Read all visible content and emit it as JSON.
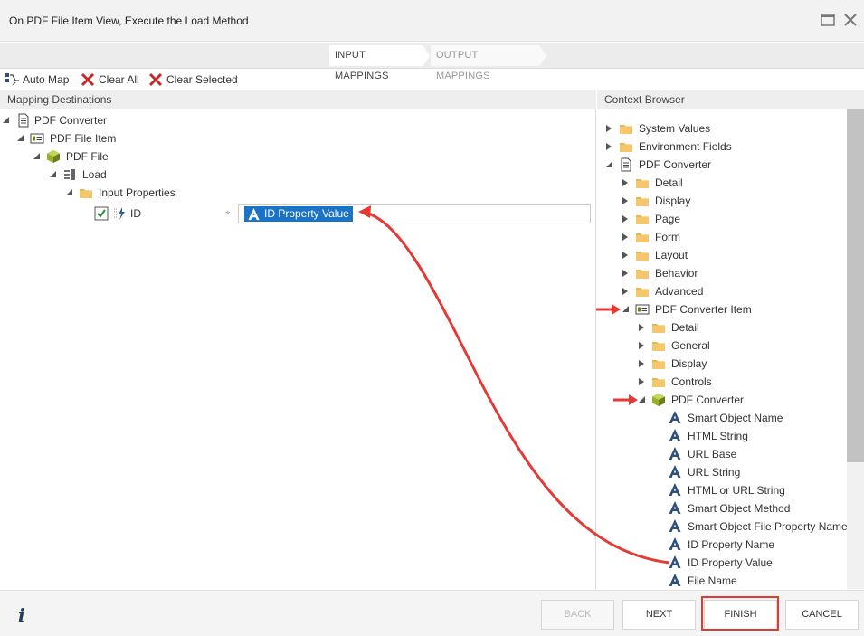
{
  "window": {
    "title": "On PDF File Item View, Execute the Load Method"
  },
  "steps": [
    {
      "label": "INPUT MAPPINGS",
      "active": true
    },
    {
      "label": "OUTPUT MAPPINGS",
      "active": false
    }
  ],
  "toolbar": {
    "auto_map": "Auto Map",
    "clear_all": "Clear All",
    "clear_selected": "Clear Selected"
  },
  "left_pane": {
    "header": "Mapping Destinations",
    "tree": {
      "n0": "PDF Converter",
      "n1": "PDF File Item",
      "n2": "PDF File",
      "n3": "Load",
      "n4": "Input Properties",
      "n5": "ID"
    },
    "id_checked": true,
    "mapping_value": "ID Property Value"
  },
  "right_pane": {
    "header": "Context Browser",
    "tree": {
      "r0": "System Values",
      "r1": "Environment Fields",
      "r2": "PDF Converter",
      "r3": "Detail",
      "r4": "Display",
      "r5": "Page",
      "r6": "Form",
      "r7": "Layout",
      "r8": "Behavior",
      "r9": "Advanced",
      "r10": "PDF Converter Item",
      "r11": "Detail",
      "r12": "General",
      "r13": "Display",
      "r14": "Controls",
      "r15": "PDF Converter",
      "r16": "Smart Object Name",
      "r17": "HTML String",
      "r18": "URL Base",
      "r19": "URL String",
      "r20": "HTML or URL String",
      "r21": "Smart Object Method",
      "r22": "Smart Object File Property Name",
      "r23": "ID Property Name",
      "r24": "ID Property Value",
      "r25": "File Name"
    }
  },
  "footer": {
    "back": "BACK",
    "next": "NEXT",
    "finish": "FINISH",
    "cancel": "CANCEL"
  },
  "colors": {
    "accent": "#1a73c7",
    "annotation": "#e53935",
    "folder": "#f0b54a",
    "smartobject": "#7a8a1e"
  }
}
